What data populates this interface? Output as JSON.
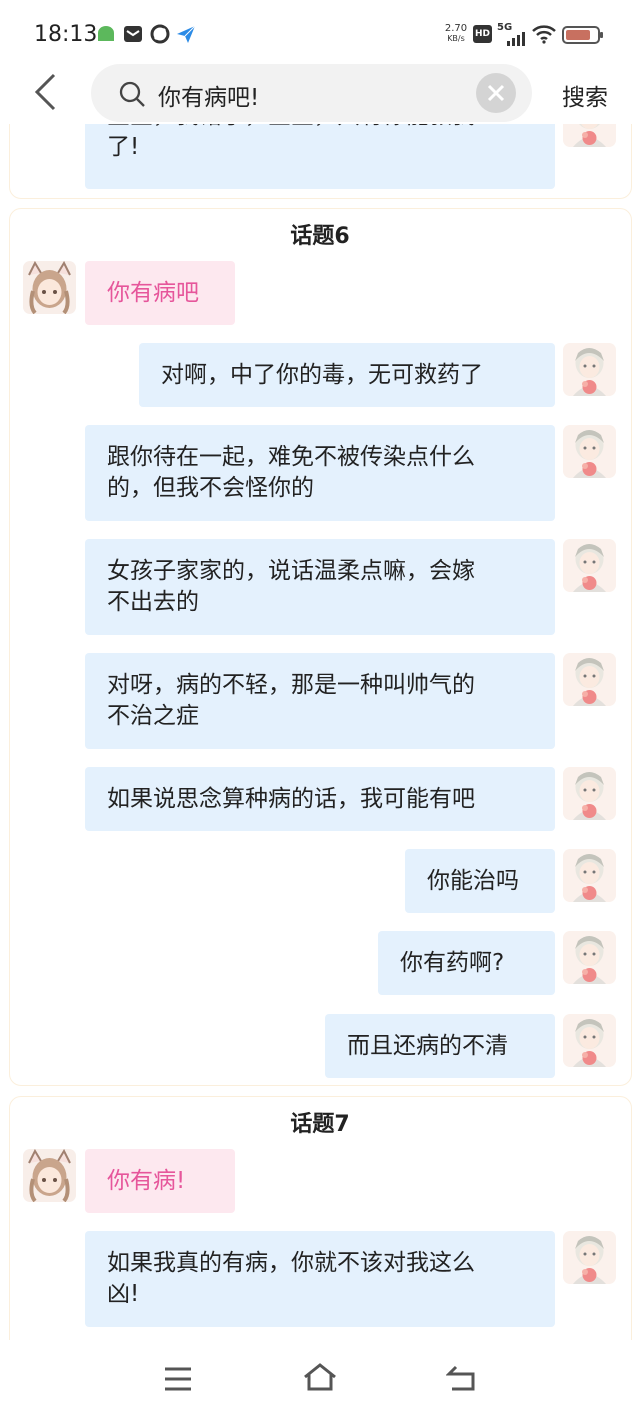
{
  "status_bar": {
    "time": "18:13",
    "net_speed_top": "2.70",
    "net_speed_bottom": "KB/s",
    "hd": "HD",
    "network": "5G",
    "icons": [
      "android-icon",
      "mail-icon",
      "sync-icon",
      "send-icon",
      "signal-icon",
      "wifi-icon",
      "battery-icon"
    ]
  },
  "search": {
    "query": "你有病吧!",
    "button": "搜索"
  },
  "partial_card": {
    "bubble_line1": "宝宝，我错了，宝宝，只有你能救我",
    "bubble_line2": "了!"
  },
  "topic6": {
    "title": "话题6",
    "user_message": "你有病吧",
    "replies": [
      [
        "对啊，中了你的毒，无可救药了"
      ],
      [
        "跟你待在一起，难免不被传染点什么",
        "的，但我不会怪你的"
      ],
      [
        "女孩子家家的，说话温柔点嘛，会嫁",
        "不出去的"
      ],
      [
        "对呀，病的不轻，那是一种叫帅气的",
        "不治之症"
      ],
      [
        "如果说思念算种病的话，我可能有吧"
      ],
      [
        "你能治吗"
      ],
      [
        "你有药啊?"
      ],
      [
        "而且还病的不清"
      ]
    ]
  },
  "topic7": {
    "title": "话题7",
    "user_message": "你有病!",
    "replies": [
      [
        "如果我真的有病，你就不该对我这么",
        "凶!"
      ]
    ]
  },
  "nav": {
    "icons": [
      "menu-icon",
      "home-icon",
      "back-icon"
    ]
  }
}
